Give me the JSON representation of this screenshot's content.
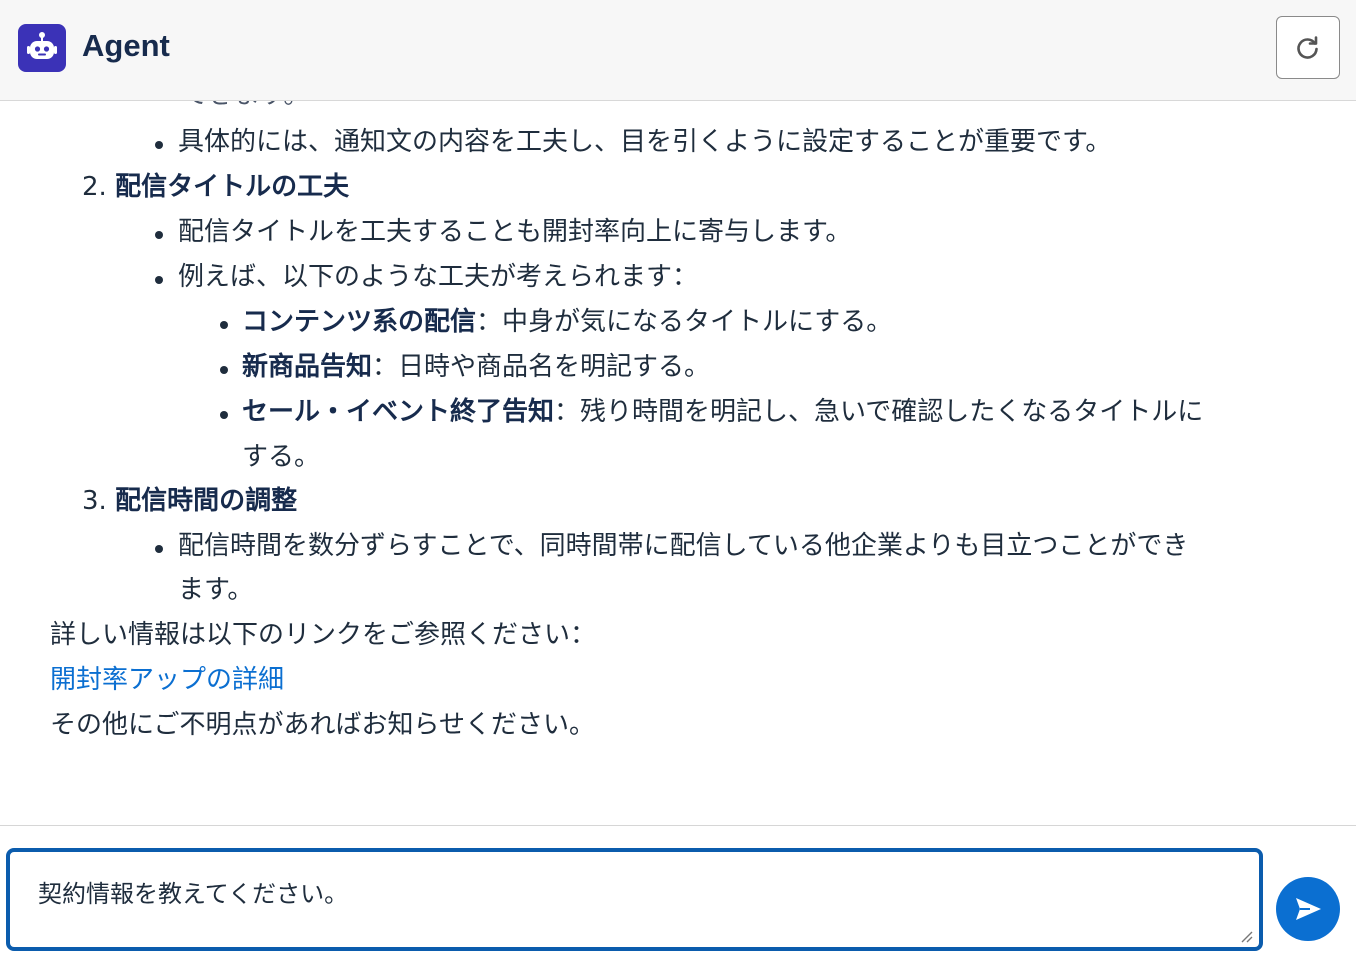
{
  "header": {
    "title": "Agent",
    "logo_icon": "robot-icon",
    "refresh_icon": "refresh-icon"
  },
  "message": {
    "cut_off_text": "できます。",
    "item1_bullet": "具体的には、通知文の内容を工夫し、目を引くように設定することが重要です。",
    "section2": {
      "number": "2.",
      "title": "配信タイトルの工夫",
      "bullet1": "配信タイトルを工夫することも開封率向上に寄与します。",
      "bullet2": "例えば、以下のような工夫が考えられます：",
      "subitems": [
        {
          "term": "コンテンツ系の配信",
          "desc": "：中身が気になるタイトルにする。"
        },
        {
          "term": "新商品告知",
          "desc": "：日時や商品名を明記する。"
        },
        {
          "term": "セール・イベント終了告知",
          "desc": "：残り時間を明記し、急いで確認したくなるタイトルに",
          "desc2": "する。"
        }
      ]
    },
    "section3": {
      "number": "3.",
      "title": "配信時間の調整",
      "bullet1_line1": "配信時間を数分ずらすことで、同時間帯に配信している他企業よりも目立つことができ",
      "bullet1_line2": "ます。"
    },
    "more_info": "詳しい情報は以下のリンクをご参照ください：",
    "link_text": "開封率アップの詳細",
    "closing": "その他にご不明点があればお知らせください。"
  },
  "composer": {
    "input_value": "契約情報を教えてください。",
    "send_icon": "send-icon"
  },
  "colors": {
    "brand": "#3b32b7",
    "accent": "#0b6fd1",
    "input_border": "#0b5cad"
  }
}
